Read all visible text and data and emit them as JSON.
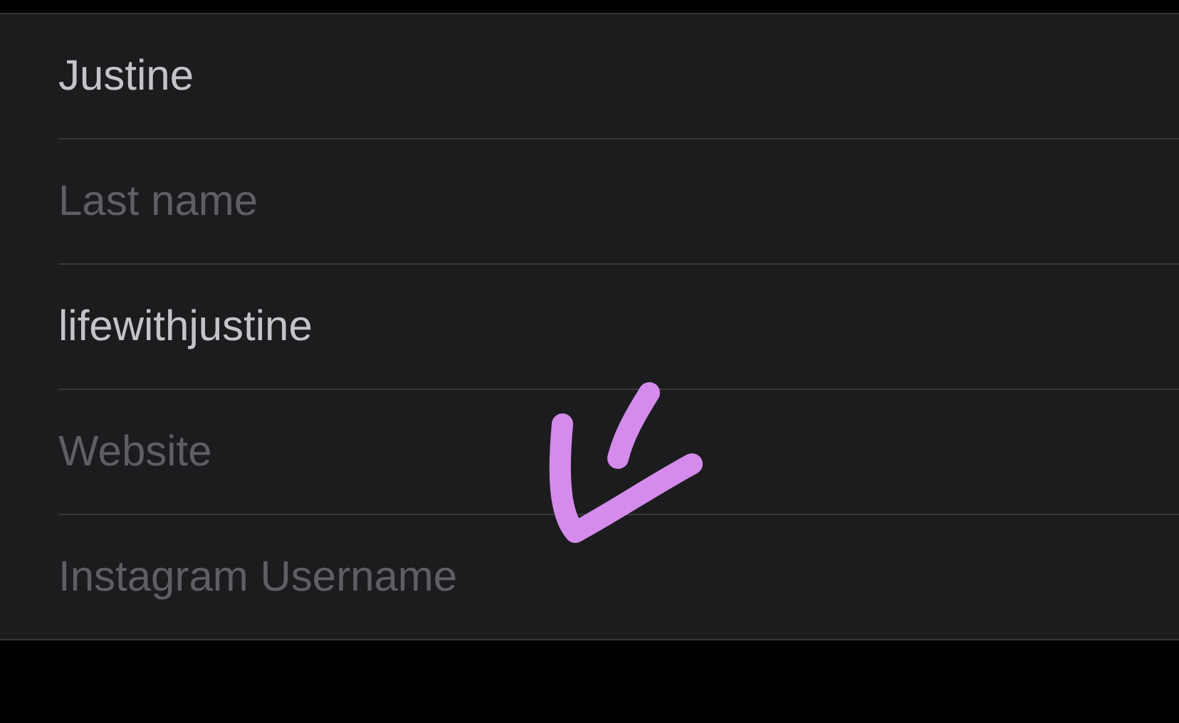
{
  "fields": [
    {
      "value": "Justine"
    },
    {
      "placeholder": "Last name"
    },
    {
      "value": "lifewithjustine"
    },
    {
      "placeholder": "Website"
    },
    {
      "placeholder": "Instagram Username"
    }
  ]
}
